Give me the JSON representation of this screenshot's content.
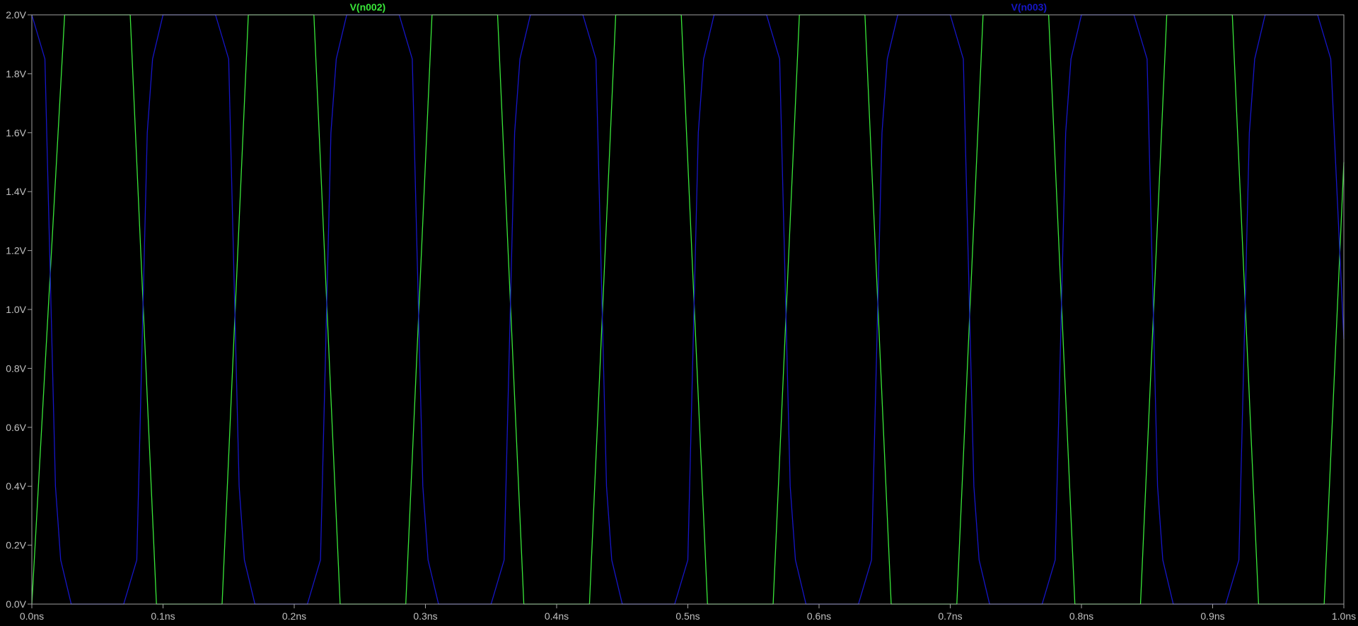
{
  "window": {
    "title": ""
  },
  "colors": {
    "background": "#000000",
    "frame": "#a0a0a0",
    "tick_text": "#c0c0c0",
    "n002": "#39e739",
    "n003": "#1616c8"
  },
  "chart_data": {
    "type": "line",
    "title": "",
    "xlabel": "",
    "ylabel": "",
    "xlim": [
      0,
      1.0
    ],
    "ylim": [
      0,
      2.0
    ],
    "grid": false,
    "legend": "top, labels above plot area",
    "x_unit": "ns",
    "y_unit": "V",
    "x_ticks": [
      "0.0ns",
      "0.1ns",
      "0.2ns",
      "0.3ns",
      "0.4ns",
      "0.5ns",
      "0.6ns",
      "0.7ns",
      "0.8ns",
      "0.9ns",
      "1.0ns"
    ],
    "y_ticks": [
      "0.0V",
      "0.2V",
      "0.4V",
      "0.6V",
      "0.8V",
      "1.0V",
      "1.2V",
      "1.4V",
      "1.6V",
      "1.8V",
      "2.0V"
    ],
    "series": [
      {
        "name": "V(n002)",
        "color": "#39e739",
        "x": [
          0.0,
          0.025,
          0.075,
          0.095,
          0.145,
          0.165,
          0.215,
          0.235,
          0.285,
          0.305,
          0.355,
          0.375,
          0.425,
          0.445,
          0.495,
          0.515,
          0.565,
          0.585,
          0.635,
          0.655,
          0.705,
          0.725,
          0.775,
          0.795,
          0.845,
          0.865,
          0.915,
          0.935,
          0.985,
          1.0
        ],
        "y": [
          0.0,
          2.0,
          2.0,
          0.0,
          0.0,
          2.0,
          2.0,
          0.0,
          0.0,
          2.0,
          2.0,
          0.0,
          0.0,
          2.0,
          2.0,
          0.0,
          0.0,
          2.0,
          2.0,
          0.0,
          0.0,
          2.0,
          2.0,
          0.0,
          0.0,
          2.0,
          2.0,
          0.0,
          0.0,
          1.5
        ]
      },
      {
        "name": "V(n003)",
        "color": "#1616c8",
        "x": [
          0.0,
          0.01,
          0.018,
          0.022,
          0.03,
          0.07,
          0.08,
          0.088,
          0.092,
          0.1,
          0.14,
          0.15,
          0.158,
          0.162,
          0.17,
          0.21,
          0.22,
          0.228,
          0.232,
          0.24,
          0.28,
          0.29,
          0.298,
          0.302,
          0.31,
          0.35,
          0.36,
          0.368,
          0.372,
          0.38,
          0.42,
          0.43,
          0.438,
          0.442,
          0.45,
          0.49,
          0.5,
          0.508,
          0.512,
          0.52,
          0.56,
          0.57,
          0.578,
          0.582,
          0.59,
          0.63,
          0.64,
          0.648,
          0.652,
          0.66,
          0.7,
          0.71,
          0.718,
          0.722,
          0.73,
          0.77,
          0.78,
          0.788,
          0.792,
          0.8,
          0.84,
          0.85,
          0.858,
          0.862,
          0.87,
          0.91,
          0.92,
          0.928,
          0.932,
          0.94,
          0.98,
          0.99,
          1.0
        ],
        "y": [
          2.0,
          1.85,
          0.4,
          0.15,
          0.0,
          0.0,
          0.15,
          1.6,
          1.85,
          2.0,
          2.0,
          1.85,
          0.4,
          0.15,
          0.0,
          0.0,
          0.15,
          1.6,
          1.85,
          2.0,
          2.0,
          1.85,
          0.4,
          0.15,
          0.0,
          0.0,
          0.15,
          1.6,
          1.85,
          2.0,
          2.0,
          1.85,
          0.4,
          0.15,
          0.0,
          0.0,
          0.15,
          1.6,
          1.85,
          2.0,
          2.0,
          1.85,
          0.4,
          0.15,
          0.0,
          0.0,
          0.15,
          1.6,
          1.85,
          2.0,
          2.0,
          1.85,
          0.4,
          0.15,
          0.0,
          0.0,
          0.15,
          1.6,
          1.85,
          2.0,
          2.0,
          1.85,
          0.4,
          0.15,
          0.0,
          0.0,
          0.15,
          1.6,
          1.85,
          2.0,
          2.0,
          1.85,
          0.9
        ]
      }
    ]
  }
}
